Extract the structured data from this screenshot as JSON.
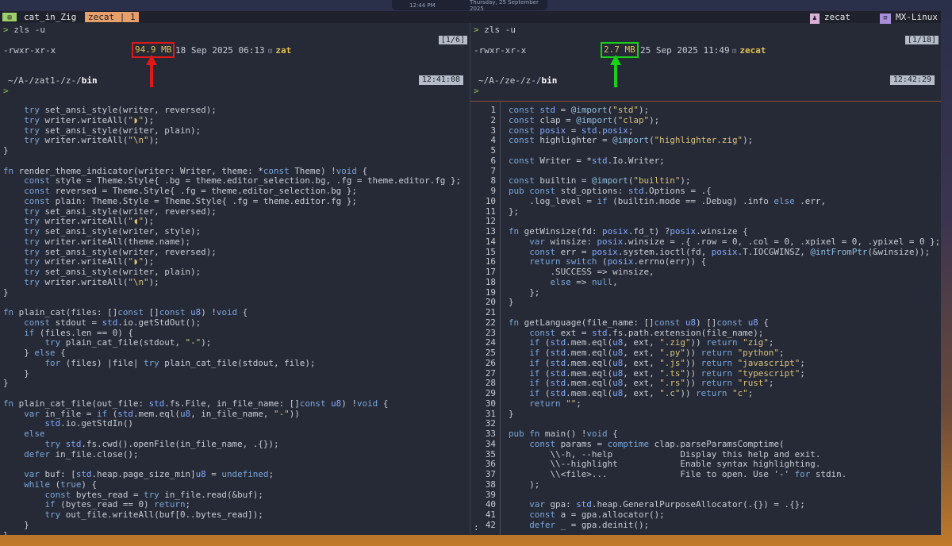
{
  "system_panel": {
    "clock": "12:44 PM",
    "date": "Thursday, 25 September 2025"
  },
  "tabbar": {
    "icon": "terminal-icon",
    "title": "cat_in_Zig",
    "session_label": "zecat | 1",
    "user_label": "zecat",
    "distro_label": "MX-Linux"
  },
  "left": {
    "command": "zls -u",
    "counter": "[1/6]",
    "permissions": "-rwxr-xr-x",
    "size": "94.9 MB",
    "date": "18 Sep 2025 06:13",
    "file_name": "zat",
    "cwd_prefix": "~/A-/zat1-/z-/",
    "cwd_last": "bin",
    "time": "12:41:08",
    "prompt_char": ">",
    "highlight_color": "#e01818",
    "code_lines": [
      "    try set_ansi_style(writer, reversed);",
      "    try writer.writeAll(\"◗\");",
      "    try set_ansi_style(writer, plain);",
      "    try writer.writeAll(\"\\n\");",
      "}",
      "",
      "fn render_theme_indicator(writer: Writer, theme: *const Theme) !void {",
      "    const style = Theme.Style{ .bg = theme.editor_selection.bg, .fg = theme.editor.fg };",
      "    const reversed = Theme.Style{ .fg = theme.editor_selection.bg };",
      "    const plain: Theme.Style = Theme.Style{ .fg = theme.editor.fg };",
      "    try set_ansi_style(writer, reversed);",
      "    try writer.writeAll(\"◖\");",
      "    try set_ansi_style(writer, style);",
      "    try writer.writeAll(theme.name);",
      "    try set_ansi_style(writer, reversed);",
      "    try writer.writeAll(\"◗\");",
      "    try set_ansi_style(writer, plain);",
      "    try writer.writeAll(\"\\n\");",
      "}",
      "",
      "fn plain_cat(files: []const []const u8) !void {",
      "    const stdout = std.io.getStdOut();",
      "    if (files.len == 0) {",
      "        try plain_cat_file(stdout, \"-\");",
      "    } else {",
      "        for (files) |file| try plain_cat_file(stdout, file);",
      "    }",
      "}",
      "",
      "fn plain_cat_file(out_file: std.fs.File, in_file_name: []const u8) !void {",
      "    var in_file = if (std.mem.eql(u8, in_file_name, \"-\"))",
      "        std.io.getStdIn()",
      "    else",
      "        try std.fs.cwd().openFile(in_file_name, .{});",
      "    defer in_file.close();",
      "",
      "    var buf: [std.heap.page_size_min]u8 = undefined;",
      "    while (true) {",
      "        const bytes_read = try in_file.read(&buf);",
      "        if (bytes_read == 0) return;",
      "        try out_file.writeAll(buf[0..bytes_read]);",
      "    }",
      "}"
    ]
  },
  "right": {
    "command": "zls -u",
    "counter": "[1/18]",
    "permissions": "-rwxr-xr-x",
    "size": "2.7 MB",
    "date": "25 Sep 2025 11:49",
    "file_name": "zecat",
    "cwd_prefix": "~/A-/ze-/z-/",
    "cwd_last": "bin",
    "time": "12:42:29",
    "prompt_char": ">",
    "highlight_color": "#18d018",
    "status_char": ":",
    "line_numbers": [
      "1",
      "2",
      "3",
      "4",
      "5",
      "6",
      "7",
      "8",
      "9",
      "10",
      "11",
      "12",
      "13",
      "14",
      "15",
      "16",
      "17",
      "18",
      "19",
      "20",
      "21",
      "22",
      "23",
      "24",
      "25",
      "26",
      "27",
      "28",
      "29",
      "30",
      "31",
      "32",
      "33",
      "34",
      "35",
      "36",
      "37",
      "38",
      "39",
      "40",
      "41",
      "42"
    ],
    "code_lines": [
      "const std = @import(\"std\");",
      "const clap = @import(\"clap\");",
      "const posix = std.posix;",
      "const highlighter = @import(\"highlighter.zig\");",
      "",
      "const Writer = *std.Io.Writer;",
      "",
      "const builtin = @import(\"builtin\");",
      "pub const std_options: std.Options = .{",
      "    .log_level = if (builtin.mode == .Debug) .info else .err,",
      "};",
      "",
      "fn getWinsize(fd: posix.fd_t) ?posix.winsize {",
      "    var winsize: posix.winsize = .{ .row = 0, .col = 0, .xpixel = 0, .ypixel = 0 };",
      "    const err = posix.system.ioctl(fd, posix.T.IOCGWINSZ, @intFromPtr(&winsize));",
      "    return switch (posix.errno(err)) {",
      "        .SUCCESS => winsize,",
      "        else => null,",
      "    };",
      "}",
      "",
      "fn getLanguage(file_name: []const u8) []const u8 {",
      "    const ext = std.fs.path.extension(file_name);",
      "    if (std.mem.eql(u8, ext, \".zig\")) return \"zig\";",
      "    if (std.mem.eql(u8, ext, \".py\")) return \"python\";",
      "    if (std.mem.eql(u8, ext, \".js\")) return \"javascript\";",
      "    if (std.mem.eql(u8, ext, \".ts\")) return \"typescript\";",
      "    if (std.mem.eql(u8, ext, \".rs\")) return \"rust\";",
      "    if (std.mem.eql(u8, ext, \".c\")) return \"c\";",
      "    return \"\";",
      "}",
      "",
      "pub fn main() !void {",
      "    const params = comptime clap.parseParamsComptime(",
      "        \\\\-h, --help             Display this help and exit.",
      "        \\\\--highlight            Enable syntax highlighting.",
      "        \\\\<file>...              File to open. Use '-' for stdin.",
      "    );",
      "",
      "    var gpa: std.heap.GeneralPurposeAllocator(.{}) = .{};",
      "    const a = gpa.allocator();",
      "    defer _ = gpa.deinit();"
    ]
  }
}
